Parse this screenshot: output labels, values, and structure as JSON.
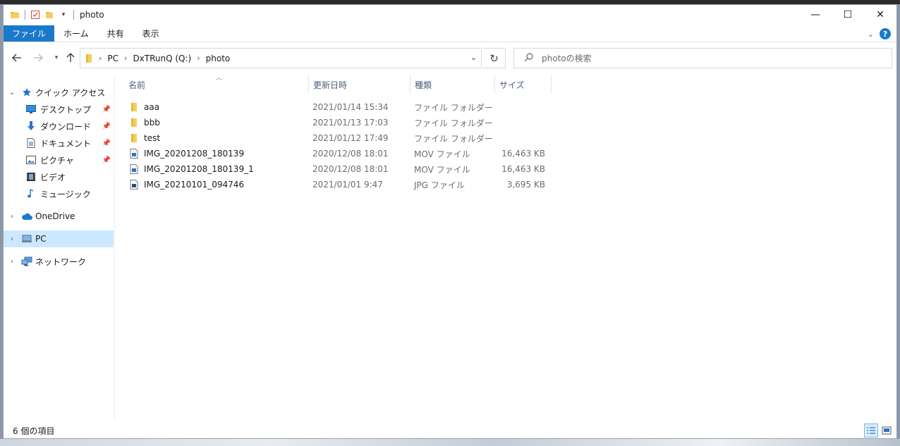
{
  "window": {
    "title": "photo",
    "minimize": "—",
    "maximize": "☐",
    "close": "✕"
  },
  "ribbon": {
    "tabs": [
      "ファイル",
      "ホーム",
      "共有",
      "表示"
    ]
  },
  "address": {
    "crumbs": [
      "PC",
      "DxTRunQ (Q:)",
      "photo"
    ]
  },
  "search": {
    "placeholder": "photoの検索"
  },
  "nav": {
    "quick_access": "クイック アクセス",
    "items": [
      {
        "label": "デスクトップ",
        "icon": "desktop-icon",
        "pinned": true
      },
      {
        "label": "ダウンロード",
        "icon": "download-icon",
        "pinned": true
      },
      {
        "label": "ドキュメント",
        "icon": "document-icon",
        "pinned": true
      },
      {
        "label": "ピクチャ",
        "icon": "pictures-icon",
        "pinned": true
      },
      {
        "label": "ビデオ",
        "icon": "video-icon",
        "pinned": false
      },
      {
        "label": "ミュージック",
        "icon": "music-icon",
        "pinned": false
      }
    ],
    "onedrive": "OneDrive",
    "pc": "PC",
    "network": "ネットワーク"
  },
  "columns": [
    "名前",
    "更新日時",
    "種類",
    "サイズ"
  ],
  "files": [
    {
      "name": "aaa",
      "date": "2021/01/14 15:34",
      "type": "ファイル フォルダー",
      "size": "",
      "icon": "folder-icon"
    },
    {
      "name": "bbb",
      "date": "2021/01/13 17:03",
      "type": "ファイル フォルダー",
      "size": "",
      "icon": "folder-icon"
    },
    {
      "name": "test",
      "date": "2021/01/12 17:49",
      "type": "ファイル フォルダー",
      "size": "",
      "icon": "folder-icon"
    },
    {
      "name": "IMG_20201208_180139",
      "date": "2020/12/08 18:01",
      "type": "MOV ファイル",
      "size": "16,463 KB",
      "icon": "mov-file-icon"
    },
    {
      "name": "IMG_20201208_180139_1",
      "date": "2020/12/08 18:01",
      "type": "MOV ファイル",
      "size": "16,463 KB",
      "icon": "mov-file-icon"
    },
    {
      "name": "IMG_20210101_094746",
      "date": "2021/01/01 9:47",
      "type": "JPG ファイル",
      "size": "3,695 KB",
      "icon": "jpg-file-icon"
    }
  ],
  "status": {
    "count": "6 個の項目"
  }
}
